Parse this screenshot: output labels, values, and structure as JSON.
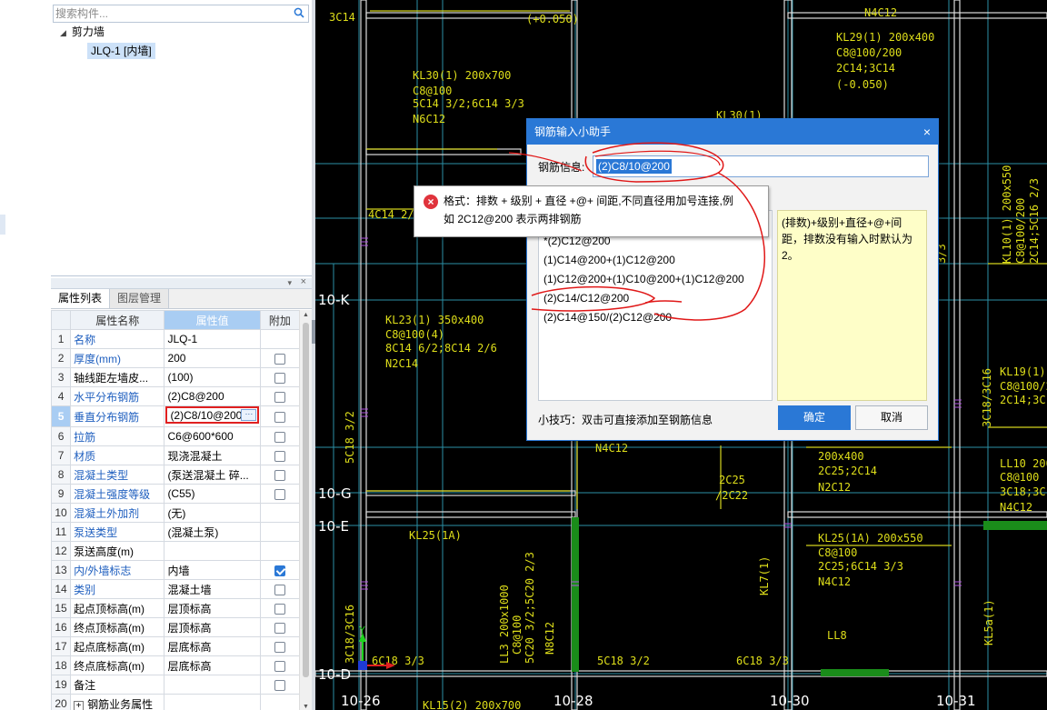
{
  "component_panel": {
    "search_placeholder": "搜索构件...",
    "tree_root": "剪力墙",
    "tree_child": "JLQ-1 [内墙]"
  },
  "property_panel": {
    "tabs": [
      "属性列表",
      "图层管理"
    ],
    "columns": [
      "属性名称",
      "属性值",
      "附加"
    ],
    "rows": [
      {
        "num": "1",
        "name": "名称",
        "value": "JLQ-1",
        "blue": true,
        "checkbox": "none"
      },
      {
        "num": "2",
        "name": "厚度(mm)",
        "value": "200",
        "blue": true,
        "checkbox": "unchecked"
      },
      {
        "num": "3",
        "name": "轴线距左墙皮...",
        "value": "(100)",
        "blue": false,
        "checkbox": "unchecked"
      },
      {
        "num": "4",
        "name": "水平分布钢筋",
        "value": "(2)C8@200",
        "blue": true,
        "checkbox": "unchecked"
      },
      {
        "num": "5",
        "name": "垂直分布钢筋",
        "value": "(2)C8/10@200",
        "blue": true,
        "checkbox": "unchecked",
        "editing": true
      },
      {
        "num": "6",
        "name": "拉筋",
        "value": "C6@600*600",
        "blue": true,
        "checkbox": "unchecked"
      },
      {
        "num": "7",
        "name": "材质",
        "value": "现浇混凝土",
        "blue": true,
        "checkbox": "unchecked"
      },
      {
        "num": "8",
        "name": "混凝土类型",
        "value": "(泵送混凝土 碎...",
        "blue": true,
        "checkbox": "unchecked"
      },
      {
        "num": "9",
        "name": "混凝土强度等级",
        "value": "(C55)",
        "blue": true,
        "checkbox": "unchecked"
      },
      {
        "num": "10",
        "name": "混凝土外加剂",
        "value": "(无)",
        "blue": true,
        "checkbox": "none"
      },
      {
        "num": "11",
        "name": "泵送类型",
        "value": "(混凝土泵)",
        "blue": true,
        "checkbox": "none"
      },
      {
        "num": "12",
        "name": "泵送高度(m)",
        "value": "",
        "blue": false,
        "checkbox": "none"
      },
      {
        "num": "13",
        "name": "内/外墙标志",
        "value": "内墙",
        "blue": true,
        "checkbox": "checked"
      },
      {
        "num": "14",
        "name": "类别",
        "value": "混凝土墙",
        "blue": true,
        "checkbox": "unchecked"
      },
      {
        "num": "15",
        "name": "起点顶标高(m)",
        "value": "层顶标高",
        "blue": false,
        "checkbox": "unchecked"
      },
      {
        "num": "16",
        "name": "终点顶标高(m)",
        "value": "层顶标高",
        "blue": false,
        "checkbox": "unchecked"
      },
      {
        "num": "17",
        "name": "起点底标高(m)",
        "value": "层底标高",
        "blue": false,
        "checkbox": "unchecked"
      },
      {
        "num": "18",
        "name": "终点底标高(m)",
        "value": "层底标高",
        "blue": false,
        "checkbox": "unchecked"
      },
      {
        "num": "19",
        "name": "备注",
        "value": "",
        "blue": false,
        "checkbox": "unchecked"
      },
      {
        "num": "20",
        "name": "钢筋业务属性",
        "value": "",
        "blue": false,
        "checkbox": "none",
        "expander": "+"
      }
    ]
  },
  "dialog": {
    "title": "钢筋输入小助手",
    "close": "×",
    "field_label": "钢筋信息:",
    "field_value": "(2)C8/10@200",
    "list_items": [
      "*(2)C12@200",
      "(1)C14@200+(1)C12@200",
      "(1)C12@200+(1)C10@200+(1)C12@200",
      "(2)C14/C12@200",
      "(2)C14@150/(2)C12@200"
    ],
    "tip_text": "(排数)+级别+直径+@+间距，排数没有输入时默认为2。",
    "hint": "小技巧：双击可直接添加至钢筋信息",
    "ok_label": "确定",
    "cancel_label": "取消"
  },
  "error_tooltip": {
    "icon": "×",
    "line1": "格式：排数 + 级别 + 直径 +@+ 间距,不同直径用加号连接,例",
    "line2": "如 2C12@200 表示两排钢筋"
  },
  "cad": {
    "colors": {
      "background": "#000000",
      "axis": "#3aa0b8",
      "wall": "#e6e6e6",
      "text": "#e8e81a",
      "beam_label": "#e8e81a",
      "hatch": "#b050e0",
      "green": "#1a8c1a"
    },
    "axis_labels": [
      "10-K",
      "10-G",
      "10-E",
      "10-D",
      "10-26",
      "10-28",
      "10-30",
      "10-31"
    ],
    "texts": {
      "t1": "3C14",
      "t2": "(+0.050)",
      "t3": "N4C12",
      "t4": "KL29(1) 200x400",
      "t5": "C8@100/200",
      "t6": "2C14;3C14",
      "t7": "(-0.050)",
      "t8": "KL30(1) 200x700",
      "t9": "C8@100",
      "t10": "5C14 3/2;6C14 3/3",
      "t11": "N6C12",
      "t12": "KL30(1)",
      "t13": "4C14 2/2",
      "t14": "KL23(1) 350x400",
      "t15": "C8@100(4)",
      "t16": "8C14 6/2;8C14 2/6",
      "t17": "N2C14",
      "t18": "5C18 3/2",
      "t19": "N4C12",
      "t20": "2C25",
      "t21": "/2C22",
      "t22": "200x400",
      "t23": "2C25;2C14",
      "t24": "N2C12",
      "t25": "KL25(1A)",
      "t26": "KL25(1A) 200x550",
      "t27": "C8@100",
      "t28": "2C25;6C14 3/3",
      "t29": "N4C12",
      "t30": "LL3 200x1000",
      "t31": "C8@100",
      "t32": "5C20 3/2;5C20 2/3",
      "t33": "N8C12",
      "t34": "KL7(1)",
      "t35": "LL8",
      "t36": "5C18 3/2",
      "t37": "6C18 3/3",
      "t38": "6C18 3/3",
      "t39": "3C18/3C16",
      "t40": "KL19(1) 200x",
      "t41": "C8@100/2",
      "t42": "2C14;3C14",
      "t43": "LL10 200x",
      "t44": "C8@100",
      "t45": "3C18;3C18",
      "t46": "N4C12",
      "t47": "KL10(1) 200x550",
      "t48": "C8@100/200",
      "t49": "2C14;5C16 2/3",
      "t50": "3C18/3C16",
      "t51": "KL5a(1)",
      "t52": "KL15(2) 200x700",
      "t53": "3/3"
    }
  }
}
